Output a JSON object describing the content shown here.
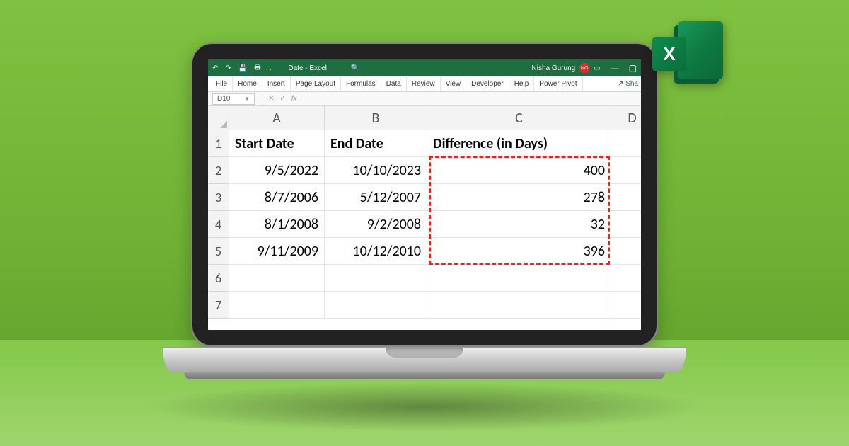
{
  "app": {
    "document_title": "Date  -  Excel",
    "user_name": "Nisha Gurung",
    "user_initials": "NG"
  },
  "titlebar_icons": {
    "undo": "↶",
    "redo": "↷",
    "save": "💾",
    "touch": "🖶",
    "search": "🔍",
    "ribbon_toggle": "⌄",
    "minimize": "—",
    "maximize": "▢"
  },
  "ribbon": {
    "tabs": [
      "File",
      "Home",
      "Insert",
      "Page Layout",
      "Formulas",
      "Data",
      "Review",
      "View",
      "Developer",
      "Help",
      "Power Pivot"
    ],
    "share": "Sha"
  },
  "formula_bar": {
    "name_box": "D10",
    "cancel": "✕",
    "confirm": "✓",
    "fx": "fx",
    "formula": ""
  },
  "sheet": {
    "columns": [
      "A",
      "B",
      "C",
      "D"
    ],
    "rows": [
      "1",
      "2",
      "3",
      "4",
      "5",
      "6",
      "7"
    ],
    "headers": {
      "A": "Start Date",
      "B": "End Date",
      "C": "Difference (in Days)"
    },
    "data": [
      {
        "A": "9/5/2022",
        "B": "10/10/2023",
        "C": "400"
      },
      {
        "A": "8/7/2006",
        "B": "5/12/2007",
        "C": "278"
      },
      {
        "A": "8/1/2008",
        "B": "9/2/2008",
        "C": "32"
      },
      {
        "A": "9/11/2009",
        "B": "10/12/2010",
        "C": "396"
      }
    ]
  },
  "logo": {
    "letter": "X"
  }
}
